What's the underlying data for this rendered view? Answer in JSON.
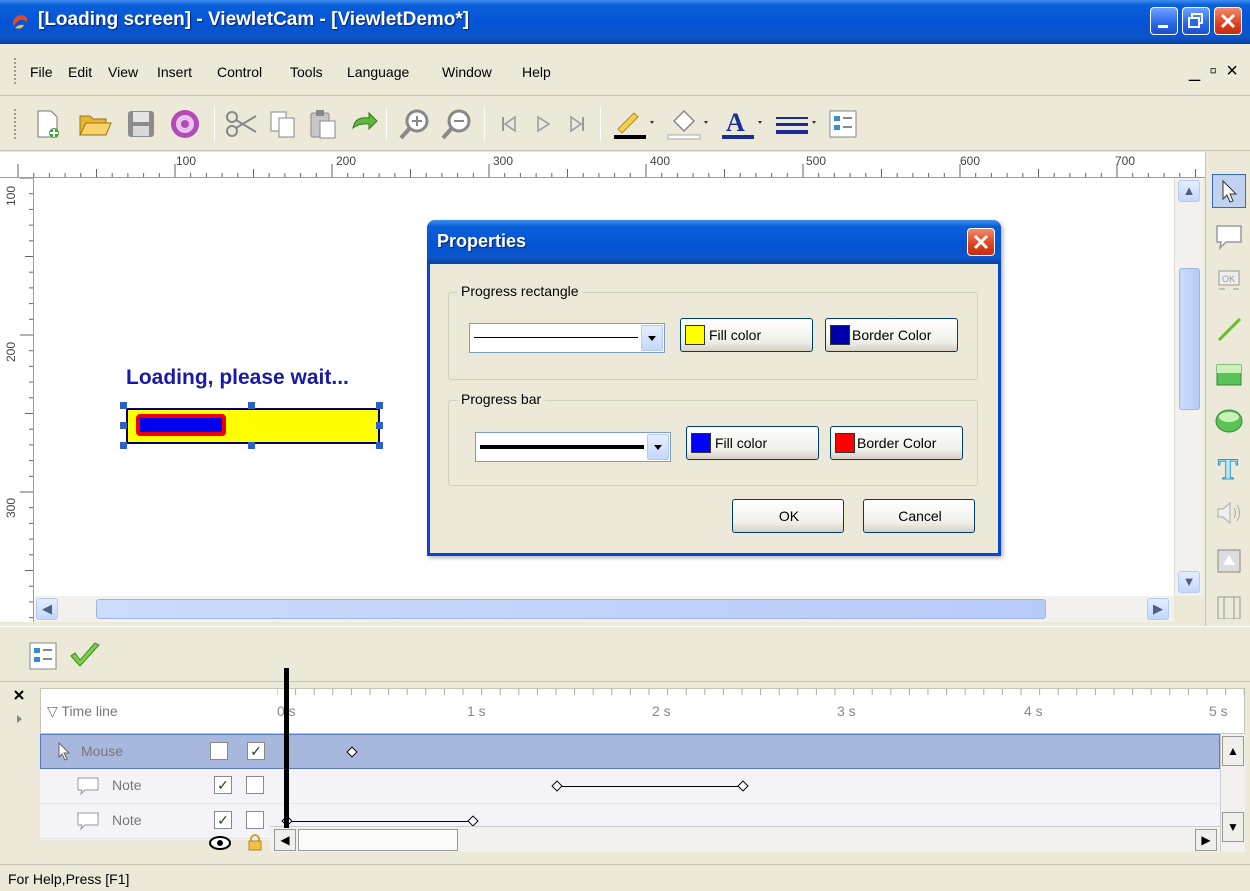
{
  "window": {
    "title": "[Loading screen] - ViewletCam - [ViewletDemo*]"
  },
  "menu": [
    "File",
    "Edit",
    "View",
    "Insert",
    "Control",
    "Tools",
    "Language",
    "Window",
    "Help"
  ],
  "mdi_buttons": "_ ▫ ×",
  "ruler": {
    "h_labels": [
      "100",
      "200",
      "300",
      "400",
      "500",
      "600",
      "700"
    ],
    "v_labels": [
      "100",
      "200",
      "300"
    ]
  },
  "canvas": {
    "loading_text": "Loading, please wait..."
  },
  "dialog": {
    "title": "Properties",
    "progress_rectangle": {
      "legend": "Progress rectangle",
      "fill_label": "Fill color",
      "border_label": "Border Color",
      "fill_color": "#ffff00",
      "border_color": "#0000aa"
    },
    "progress_bar": {
      "legend": "Progress bar",
      "fill_label": "Fill color",
      "border_label": "Border Color",
      "fill_color": "#0000ff",
      "border_color": "#ff0000"
    },
    "ok": "OK",
    "cancel": "Cancel"
  },
  "timeline": {
    "header": "Time line",
    "ticks": [
      "0 s",
      "1 s",
      "2 s",
      "3 s",
      "4 s",
      "5 s"
    ],
    "rows": [
      {
        "name": "Mouse",
        "visible": false,
        "locked": true,
        "selected": true
      },
      {
        "name": "Note",
        "visible": true,
        "locked": false,
        "selected": false
      },
      {
        "name": "Note",
        "visible": true,
        "locked": false,
        "selected": false
      }
    ]
  },
  "status": {
    "text": "For Help,Press [F1]"
  },
  "colors": {
    "titlebar": "#0654d6",
    "canvas_text": "#1a1aa8"
  }
}
